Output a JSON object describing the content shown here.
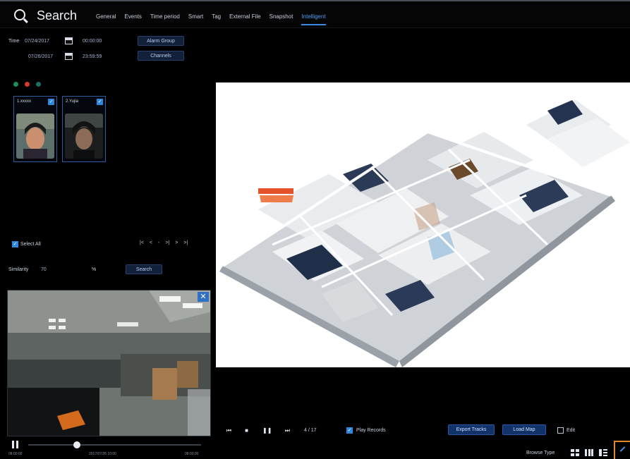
{
  "header": {
    "title": "Search",
    "tabs": [
      "General",
      "Events",
      "Time period",
      "Smart",
      "Tag",
      "External File",
      "Snapshot",
      "Intelligent"
    ],
    "active_tab": "Intelligent"
  },
  "filters": {
    "time_label": "Time",
    "start_date": "07/24/2017",
    "start_time": "00:00:00",
    "end_date": "07/26/2017",
    "end_time": "23:59:59",
    "alarm_group_button": "Alarm Group",
    "channels_button": "Channels"
  },
  "faces": [
    {
      "name": "1.xxxxx",
      "checked": true
    },
    {
      "name": "2.Yujia",
      "checked": true
    }
  ],
  "selection": {
    "select_all_label": "Select All",
    "pager": [
      "|<",
      "<",
      "-",
      ">|",
      ">",
      ">|"
    ]
  },
  "similarity": {
    "label": "Similarity",
    "value": "70",
    "unit": "%",
    "search_button": "Search"
  },
  "video": {
    "time_start": "08:00:00",
    "time_mid": "2017/07/26 10:00",
    "time_end": "08:00:00",
    "progress": 0.28
  },
  "map_controls": {
    "track_counter": "4 / 17",
    "play_records_label": "Play Records",
    "export_tracks_button": "Export Tracks",
    "load_map_button": "Load Map",
    "edit_label": "Edit"
  },
  "footer": {
    "browse_type_label": "Browse Type"
  },
  "colors": {
    "accent": "#3b8be3",
    "background": "#000000",
    "button": "#12336a",
    "highlight": "#e08a2a"
  }
}
